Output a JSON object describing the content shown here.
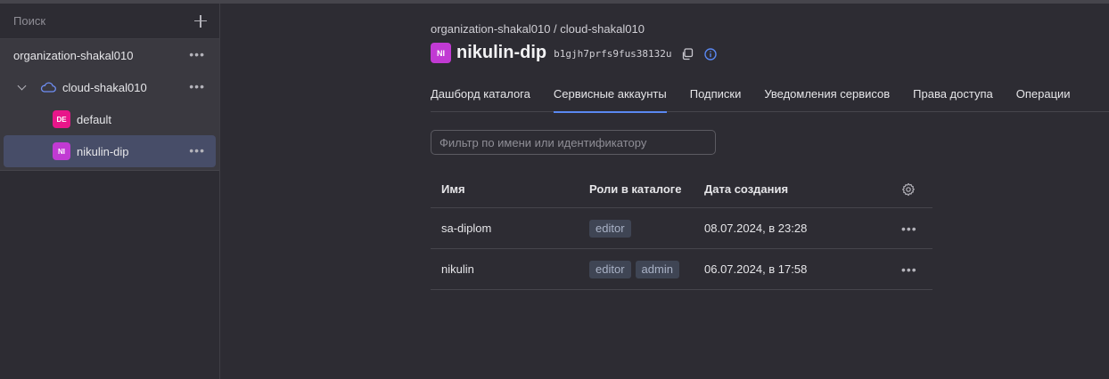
{
  "sidebar": {
    "search_label": "Поиск",
    "org": {
      "label": "organization-shakal010"
    },
    "cloud": {
      "label": "cloud-shakal010"
    },
    "folders": [
      {
        "badge": "DE",
        "label": "default"
      },
      {
        "badge": "NI",
        "label": "nikulin-dip"
      }
    ],
    "more": "•••"
  },
  "header": {
    "breadcrumb": "organization-shakal010 / cloud-shakal010",
    "badge": "NI",
    "title": "nikulin-dip",
    "id": "b1gjh7prfs9fus38132u"
  },
  "tabs": [
    {
      "label": "Дашборд каталога"
    },
    {
      "label": "Сервисные аккаунты"
    },
    {
      "label": "Подписки"
    },
    {
      "label": "Уведомления сервисов"
    },
    {
      "label": "Права доступа"
    },
    {
      "label": "Операции"
    }
  ],
  "filter": {
    "placeholder": "Фильтр по имени или идентификатору"
  },
  "table": {
    "columns": {
      "name": "Имя",
      "roles": "Роли в каталоге",
      "date": "Дата создания"
    },
    "rows": [
      {
        "name": "sa-diplom",
        "roles": [
          "editor"
        ],
        "date": "08.07.2024, в 23:28"
      },
      {
        "name": "nikulin",
        "roles": [
          "editor",
          "admin"
        ],
        "date": "06.07.2024, в 17:58"
      }
    ],
    "more": "•••"
  },
  "colors": {
    "accent": "#5a88f2",
    "badge_de": "#e8168a",
    "badge_ni": "#c13ad3",
    "selected_row": "#474d68"
  }
}
